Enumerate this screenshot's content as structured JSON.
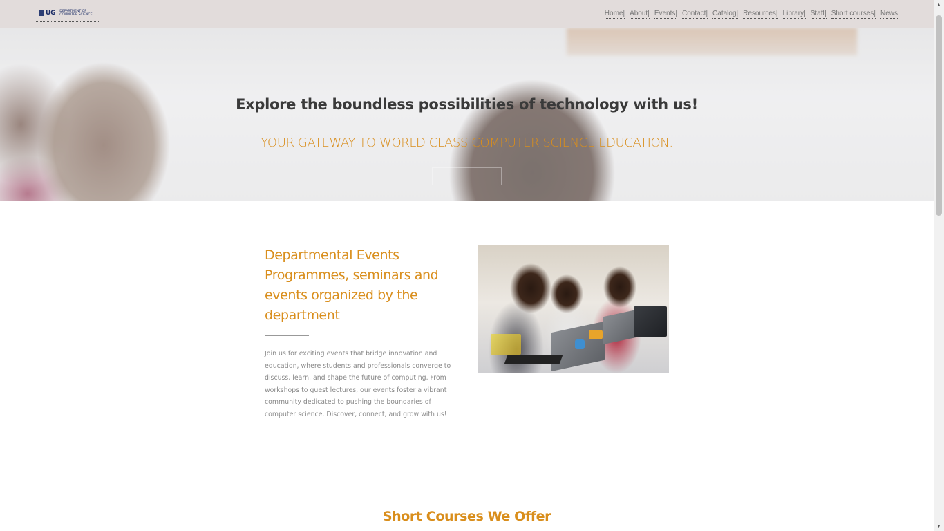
{
  "brand": {
    "logo_ug": "UG",
    "logo_dept_line1": "DEPARTMENT OF",
    "logo_dept_line2": "COMPUTER SCIENCE",
    "crest_icon": "university-crest-icon"
  },
  "nav": {
    "items": [
      {
        "label": "Home|"
      },
      {
        "label": "About|"
      },
      {
        "label": "Events|"
      },
      {
        "label": "Contact|"
      },
      {
        "label": "Catalog|"
      },
      {
        "label": "Resources|"
      },
      {
        "label": "Library|"
      },
      {
        "label": "Staff|"
      },
      {
        "label": "Short courses|"
      },
      {
        "label": "News"
      }
    ]
  },
  "hero": {
    "title": "Explore the boundless possibilities of technology with us!",
    "subtitle": "YOUR GATEWAY TO WORLD CLASS COMPUTER SCIENCE EDUCATION.",
    "button_label": ""
  },
  "events": {
    "heading": "Departmental Events Programmes, seminars and events organized by the department",
    "body": "Join us for exciting events that bridge innovation and education, where students and professionals converge to discuss, learn, and shape the future of computing. From workshops to guest lectures, our events foster a vibrant community dedicated to pushing the boundaries of computer science. Discover, connect, and grow with us!"
  },
  "courses": {
    "heading": "Short Courses We Offer"
  },
  "colors": {
    "accent": "#d98e1c",
    "topbar": "#e2dcdb",
    "nav_text": "#777777",
    "body_text": "#8a8a8a"
  }
}
